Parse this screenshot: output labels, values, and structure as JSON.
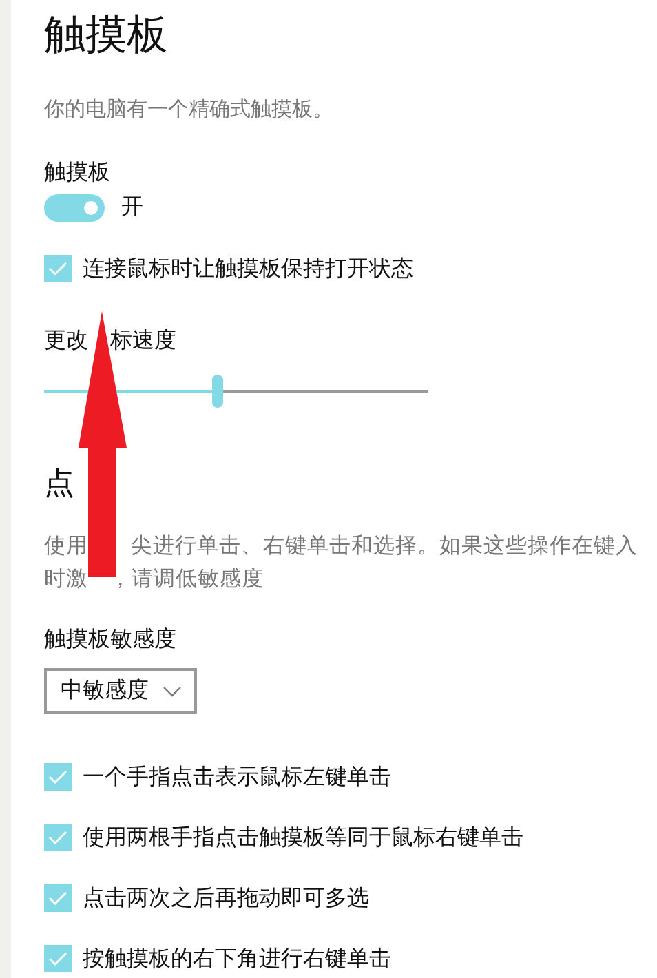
{
  "title": "触摸板",
  "subtitle": "你的电脑有一个精确式触摸板。",
  "touchpad": {
    "label": "触摸板",
    "on": true,
    "state_text": "开"
  },
  "keep_on_with_mouse": {
    "label": "连接鼠标时让触摸板保持打开状态",
    "checked": true
  },
  "cursor_speed": {
    "label_parts": [
      "更改",
      "标速度"
    ],
    "level": 0.45
  },
  "taps": {
    "heading": "点",
    "description_lines": [
      [
        "使用",
        "尖进行单击、右键单击和选择。如果这些操作在键入"
      ],
      [
        "时激",
        "，请调低敏感度"
      ]
    ],
    "sensitivity_label": "触摸板敏感度",
    "sensitivity_value": "中敏感度",
    "options": [
      {
        "label": "一个手指点击表示鼠标左键单击",
        "checked": true
      },
      {
        "label": "使用两根手指点击触摸板等同于鼠标右键单击",
        "checked": true
      },
      {
        "label": "点击两次之后再拖动即可多选",
        "checked": true
      },
      {
        "label": "按触摸板的右下角进行右键单击",
        "checked": true
      }
    ]
  }
}
